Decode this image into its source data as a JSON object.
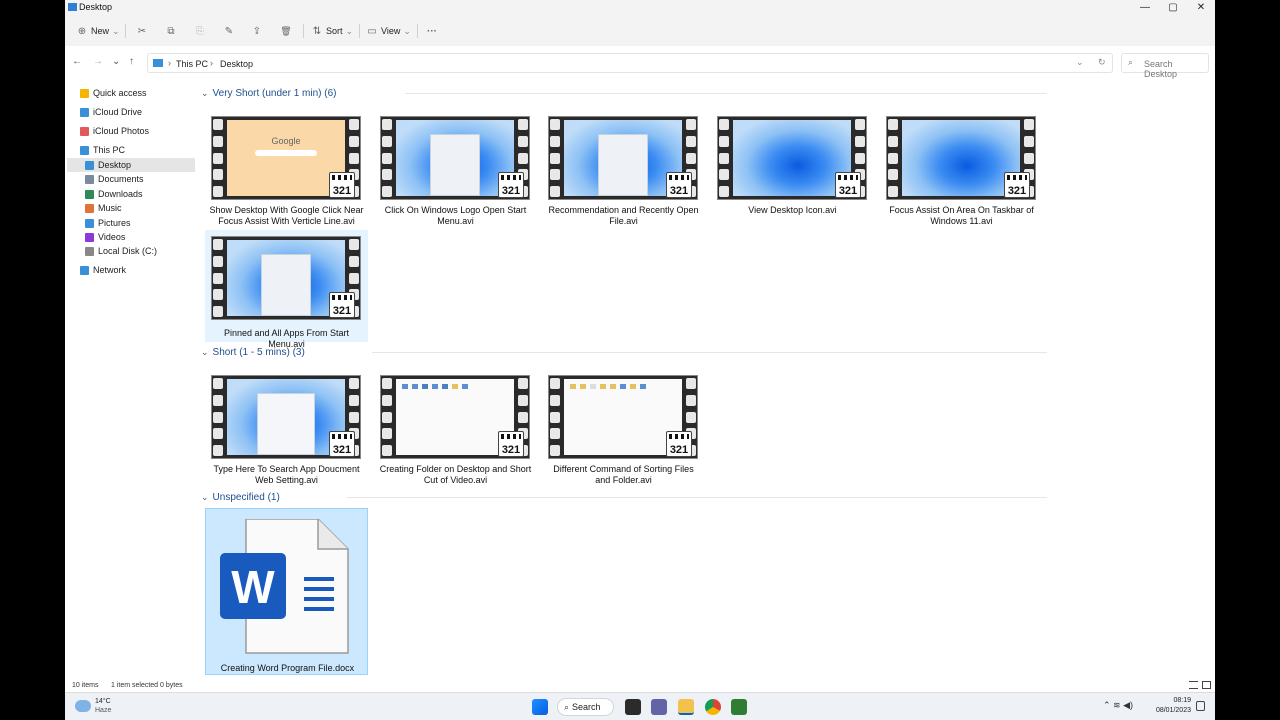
{
  "window": {
    "title": "Desktop",
    "minimize_glyph": "—",
    "maximize_glyph": "▢",
    "close_glyph": "✕"
  },
  "commandbar": {
    "new_label": "New",
    "new_glyph": "⊕",
    "cut_glyph": "✂",
    "copy_glyph": "⧉",
    "paste_glyph": "⎘",
    "rename_glyph": "✎",
    "share_glyph": "⇪",
    "delete_glyph": "🗑",
    "sort_label": "Sort",
    "sort_glyph": "⇅",
    "view_label": "View",
    "view_glyph": "▭",
    "more_glyph": "···",
    "dropdown_glyph": "⌄"
  },
  "nav": {
    "back_glyph": "←",
    "forward_glyph": "→",
    "recent_glyph": "⌄",
    "up_glyph": "↑",
    "refresh_glyph": "↻",
    "separator_glyph": "›"
  },
  "address": {
    "crumbs": [
      "This PC",
      "Desktop"
    ]
  },
  "search": {
    "placeholder": "Search Desktop",
    "icon_glyph": "⌕"
  },
  "sidebar": {
    "items": [
      {
        "label": "Quick access",
        "icon": "star-icon",
        "color": "#f4b400"
      },
      {
        "label": "iCloud Drive",
        "icon": "cloud-icon",
        "color": "#3a8fd9"
      },
      {
        "label": "iCloud Photos",
        "icon": "photos-icon",
        "color": "#e05a5a"
      },
      {
        "label": "This PC",
        "icon": "computer-icon",
        "color": "#3a8fd9"
      },
      {
        "label": "Desktop",
        "icon": "desktop-icon",
        "color": "#3a8fd9"
      },
      {
        "label": "Documents",
        "icon": "documents-icon",
        "color": "#7a8aa0"
      },
      {
        "label": "Downloads",
        "icon": "downloads-icon",
        "color": "#2e8b57"
      },
      {
        "label": "Music",
        "icon": "music-icon",
        "color": "#e0733a"
      },
      {
        "label": "Pictures",
        "icon": "pictures-icon",
        "color": "#3a8fd9"
      },
      {
        "label": "Videos",
        "icon": "videos-icon",
        "color": "#8a3ad9"
      },
      {
        "label": "Local Disk (C:)",
        "icon": "disk-icon",
        "color": "#888888"
      },
      {
        "label": "Network",
        "icon": "network-icon",
        "color": "#3a8fd9"
      }
    ]
  },
  "groups": [
    {
      "label": "Very Short (under 1 min) (6)",
      "chevron": "⌄"
    },
    {
      "label": "Short (1 - 5 mins) (3)",
      "chevron": "⌄"
    },
    {
      "label": "Unspecified (1)",
      "chevron": "⌄"
    }
  ],
  "files": [
    {
      "name": "Show Desktop With Google Click Near Focus Assist With Verticle Line.avi",
      "thumb": "google"
    },
    {
      "name": "Click On Windows Logo Open Start Menu.avi",
      "thumb": "start"
    },
    {
      "name": "Recommendation and Recently Open File.avi",
      "thumb": "start"
    },
    {
      "name": "View Desktop Icon.avi",
      "thumb": "wallpaper"
    },
    {
      "name": "Focus Assist On Area On Taskbar of Windows 11.avi",
      "thumb": "wallpaper"
    },
    {
      "name": "Pinned and All Apps From Start Menu.avi",
      "thumb": "start"
    },
    {
      "name": "Type Here To Search App Doucment Web Setting.avi",
      "thumb": "search"
    },
    {
      "name": "Creating Folder on Desktop and Short Cut of Video.avi",
      "thumb": "white"
    },
    {
      "name": "Different Command of Sorting Files and Folder.avi",
      "thumb": "white2"
    },
    {
      "name": "Creating Word Program File.docx",
      "thumb": "word"
    }
  ],
  "thumb_text": {
    "google_logo": "Google",
    "badge_number": "321",
    "word_letter": "W"
  },
  "status": {
    "count": "10 items",
    "selection": "1 item selected  0 bytes"
  },
  "taskbar": {
    "temp": "14°C",
    "weather": "Haze",
    "search_label": "Search",
    "time": "08:19",
    "date": "08/01/2023",
    "tray_glyphs": "⌃  ≋  ◀)"
  },
  "colors": {
    "selection": "#cce8ff",
    "accent": "#0067c0",
    "group_header": "#1f4f8f",
    "word_blue": "#185abd"
  }
}
